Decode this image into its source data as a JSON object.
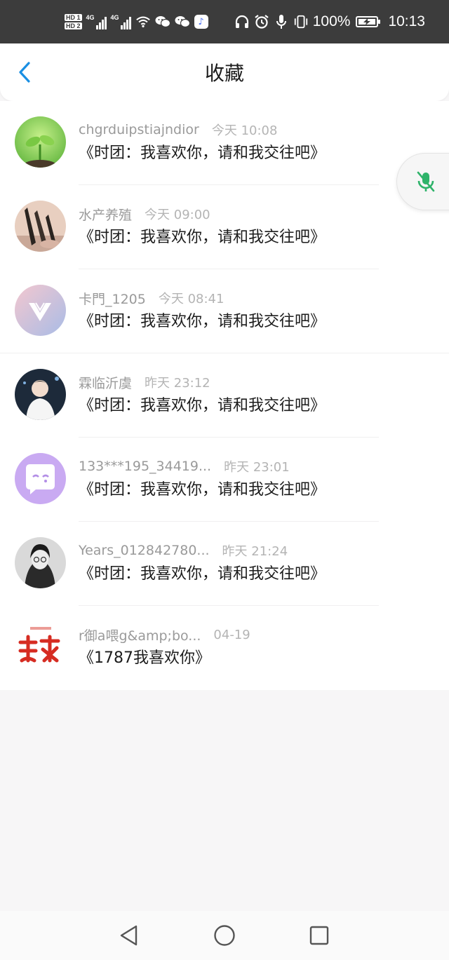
{
  "status_bar": {
    "hd1": "HD 1",
    "hd2": "HD 2",
    "net1": "4G",
    "net2": "4G",
    "battery_text": "100%",
    "battery_level": 1.0,
    "time": "10:13",
    "icons": [
      "signal-icon",
      "wifi-icon",
      "wechat-icon",
      "music-app-icon",
      "headphones-icon",
      "alarm-icon",
      "mic-icon",
      "vibrate-icon",
      "battery-icon"
    ]
  },
  "header": {
    "title": "收藏",
    "back_icon": "chevron-left-icon"
  },
  "favorites": [
    {
      "username": "chgrduipstiajndior",
      "time": "今天 10:08",
      "message": "《时团：我喜欢你，请和我交往吧》",
      "avatar": "sprout"
    },
    {
      "username": "水产养殖",
      "time": "今天 09:00",
      "message": "《时团：我喜欢你，请和我交往吧》",
      "avatar": "catch"
    },
    {
      "username": "卡門_1205",
      "time": "今天 08:41",
      "message": "《时团：我喜欢你，请和我交往吧》",
      "avatar": "logo-v"
    },
    {
      "username": "霖临沂虞",
      "time": "昨天 23:12",
      "message": "《时团：我喜欢你，请和我交往吧》",
      "avatar": "person-dark"
    },
    {
      "username": "133***195_34419...",
      "time": "昨天 23:01",
      "message": "《时团：我喜欢你，请和我交往吧》",
      "avatar": "chat-bubble"
    },
    {
      "username": "Years_012842780...",
      "time": "昨天 21:24",
      "message": "《时团：我喜欢你，请和我交往吧》",
      "avatar": "person-bw"
    },
    {
      "username": "r御a喂g&amp;bo...",
      "time": "04-19",
      "message": "《1787我喜欢你》",
      "avatar": "calligraphy"
    }
  ],
  "floating_button": {
    "icon": "mic-muted-icon",
    "color": "#2fb36a"
  },
  "nav_bar": {
    "icons": [
      "back-triangle-icon",
      "home-circle-icon",
      "recents-square-icon"
    ]
  },
  "colors": {
    "accent": "#1a8fe3",
    "background": "#f7f6f7"
  }
}
